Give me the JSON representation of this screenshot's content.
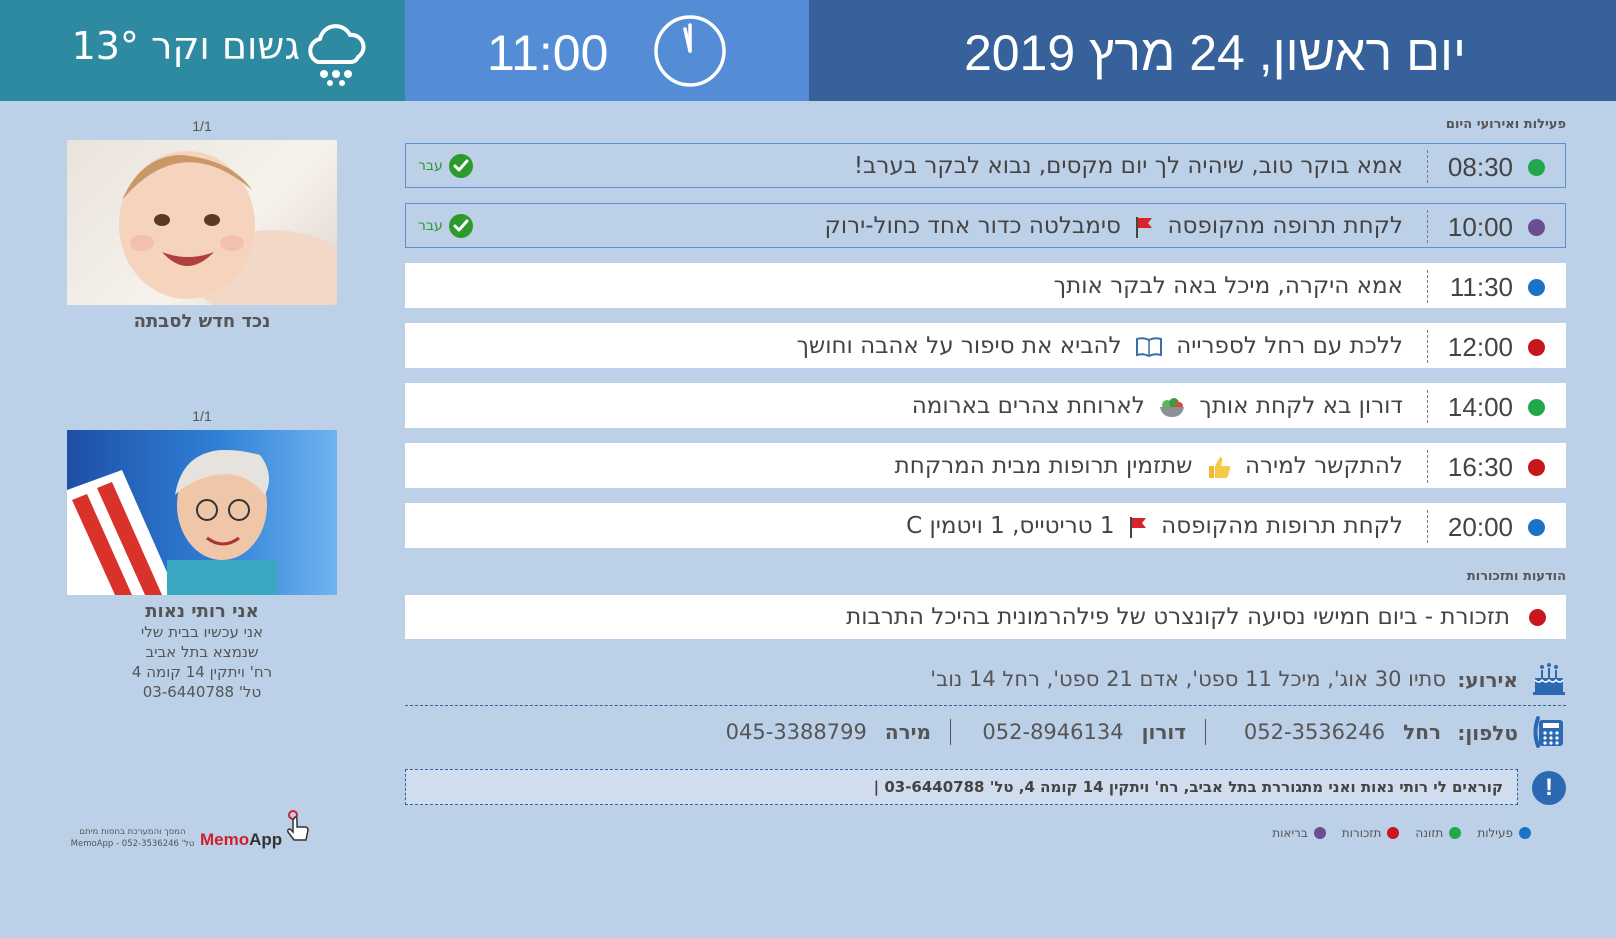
{
  "header": {
    "weather": "גשום וקר 13°",
    "weather_icon": "rain-cloud-icon",
    "time": "11:00",
    "clock_icon": "clock-icon",
    "date": "יום ראשון, 24 מרץ 2019",
    "colors": {
      "weather_bg": "#2e8aa1",
      "time_bg": "#548dd6",
      "date_bg": "#36619a"
    }
  },
  "photos": [
    {
      "counter": "1/1",
      "caption": "נכד חדש לסבתה",
      "lines": []
    },
    {
      "counter": "1/1",
      "caption": "אני רותי נאות",
      "lines": [
        "אני עכשיו בבית שלי",
        "שנמצא בתל אביב",
        "רח' ויתקין 14 קומה 4",
        "טל' 03-6440788"
      ]
    }
  ],
  "logo": {
    "brand_memo": "Memo",
    "brand_app": "App",
    "small_line1": "המסך והמערכת בחסות מיתם",
    "small_line2": "טל' 052-3536246 - MemoApp"
  },
  "sections": {
    "events_title": "פעילות ואירועי היום",
    "notices_title": "הודעות ותזכורות"
  },
  "events": [
    {
      "time": "08:30",
      "text": "אמא בוקר טוב, שיהיה לך יום מקסים, נבוא לבקר בערב!",
      "category": "green",
      "done": true,
      "done_label": "עבר"
    },
    {
      "time": "10:00",
      "text_before": "לקחת תרופה מהקופסה",
      "icon": "red-flag-icon",
      "text_after": "סימבלטה כדור אחד כחול-ירוק",
      "category": "purple",
      "done": true,
      "done_label": "עבר"
    },
    {
      "time": "11:30",
      "text": "אמא היקרה, מיכל באה לבקר אותך",
      "category": "blue",
      "done": false
    },
    {
      "time": "12:00",
      "text_before": "ללכת עם רחל לספרייה",
      "icon": "book-icon",
      "text_after": "להביא את סיפור על אהבה וחושך",
      "category": "red",
      "done": false
    },
    {
      "time": "14:00",
      "text_before": "דורון בא לקחת אותך",
      "icon": "salad-bowl-icon",
      "text_after": "לארוחת צהרים בארומה",
      "category": "green",
      "done": false
    },
    {
      "time": "16:30",
      "text_before": "להתקשר למירה",
      "icon": "thumbs-up-icon",
      "text_after": "שתזמין תרופות מבית המרקחת",
      "category": "red",
      "done": false
    },
    {
      "time": "20:00",
      "text_before": "לקחת תרופות מהקופסה",
      "icon": "red-flag-icon",
      "text_after": "1 טריטייס, 1 ויטמין C",
      "category": "blue",
      "done": false
    }
  ],
  "notice": {
    "text": "תזכורת - ביום חמישי נסיעה לקונצרט של פילהרמונית בהיכל התרבות",
    "category": "red"
  },
  "birthdays": {
    "label": "אירוע:",
    "text": "סתיו 30 אוג', מיכל 11 ספט', אדם 21 ספט', רחל 14 נוב'",
    "icon": "birthday-cake-icon"
  },
  "phones": {
    "label": "טלפון:",
    "icon": "telephone-icon",
    "contacts": [
      {
        "name": "רחל",
        "number": "052-3536246"
      },
      {
        "name": "דורון",
        "number": "052-8946134"
      },
      {
        "name": "מירה",
        "number": "045-3388799"
      }
    ]
  },
  "info": {
    "icon_symbol": "!",
    "text": "קוראים לי רותי נאות ואני מתגוררת בתל אביב, רח' ויתקין 14 קומה 4, טל' 03-6440788 |"
  },
  "legend": [
    {
      "label": "פעילות",
      "color": "#1a73c8"
    },
    {
      "label": "תזונה",
      "color": "#22a84a"
    },
    {
      "label": "תזכורות",
      "color": "#c8161d"
    },
    {
      "label": "בריאות",
      "color": "#6a4e8e"
    }
  ],
  "category_colors": {
    "green": "#22a84a",
    "purple": "#6a4e8e",
    "blue": "#1a73c8",
    "red": "#c8161d"
  }
}
